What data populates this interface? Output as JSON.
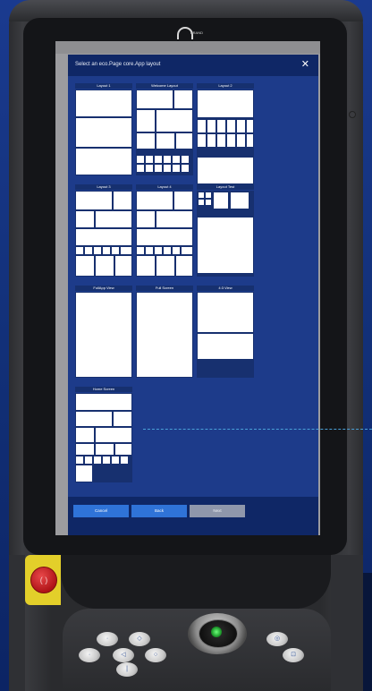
{
  "device": {
    "logo_text": "BRAND",
    "estop_symbol": "( )"
  },
  "dialog": {
    "title": "Select an eco.Page core.App layout",
    "close_symbol": "✕"
  },
  "layouts": [
    {
      "id": "layout-1",
      "label": "Layout 1"
    },
    {
      "id": "welcome-layout",
      "label": "Welcome Layout"
    },
    {
      "id": "layout-2",
      "label": "Layout 2"
    },
    {
      "id": "layout-3",
      "label": "Layout 3"
    },
    {
      "id": "layout-4",
      "label": "Layout 4"
    },
    {
      "id": "layout-test",
      "label": "Layout Test"
    },
    {
      "id": "fullapp-view",
      "label": "FullApp View"
    },
    {
      "id": "full-screen",
      "label": "Full Screen"
    },
    {
      "id": "4-3-view",
      "label": "4:3 View"
    },
    {
      "id": "home-screen",
      "label": "Home Screen"
    }
  ],
  "footer": {
    "cancel_label": "Cancel",
    "back_label": "Back",
    "next_label": "Next"
  },
  "colors": {
    "dialog_bg": "#1c3a86",
    "header_bg": "#0f2766",
    "primary_button": "#2f73d8",
    "disabled_button": "#8f97ab",
    "thumb_cell": "#ffffff"
  },
  "hardware_buttons": {
    "b1": "·",
    "b2": "◇",
    "b3": "·",
    "b4": "◁",
    "b5": "○",
    "b6": "|",
    "b7": "◎",
    "b8": "⊡"
  }
}
